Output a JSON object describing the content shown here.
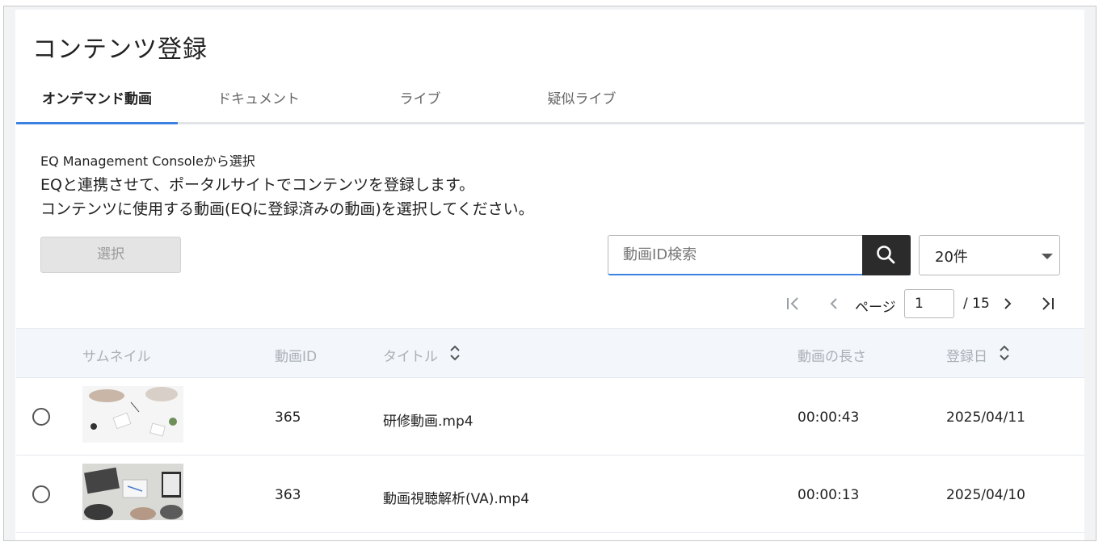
{
  "page": {
    "title": "コンテンツ登録"
  },
  "tabs": [
    {
      "label": "オンデマンド動画",
      "active": true
    },
    {
      "label": "ドキュメント",
      "active": false
    },
    {
      "label": "ライブ",
      "active": false
    },
    {
      "label": "疑似ライブ",
      "active": false
    }
  ],
  "description": {
    "heading": "EQ Management Consoleから選択",
    "line1": "EQと連携させて、ポータルサイトでコンテンツを登録します。",
    "line2": "コンテンツに使用する動画(EQに登録済みの動画)を選択してください。"
  },
  "toolbar": {
    "select_label": "選択",
    "search_placeholder": "動画ID検索",
    "search_value": "",
    "count_value": "20件"
  },
  "pager": {
    "label": "ページ",
    "current": "1",
    "total": "/ 15"
  },
  "table": {
    "headers": {
      "thumbnail": "サムネイル",
      "video_id": "動画ID",
      "title": "タイトル",
      "duration": "動画の長さ",
      "registered": "登録日"
    },
    "rows": [
      {
        "video_id": "365",
        "title": "研修動画.mp4",
        "duration": "00:00:43",
        "registered": "2025/04/11"
      },
      {
        "video_id": "363",
        "title": "動画視聴解析(VA).mp4",
        "duration": "00:00:13",
        "registered": "2025/04/10"
      }
    ]
  },
  "colors": {
    "accent": "#3b82e0",
    "search_button": "#2b2b2b",
    "header_bg": "#f3f6fa",
    "disabled_button": "#e4e4e4"
  },
  "icons": {
    "search": "search-icon",
    "first_page": "first-page-icon",
    "prev_page": "prev-page-icon",
    "next_page": "next-page-icon",
    "last_page": "last-page-icon",
    "sort": "sort-icon",
    "dropdown": "chevron-down-icon"
  }
}
